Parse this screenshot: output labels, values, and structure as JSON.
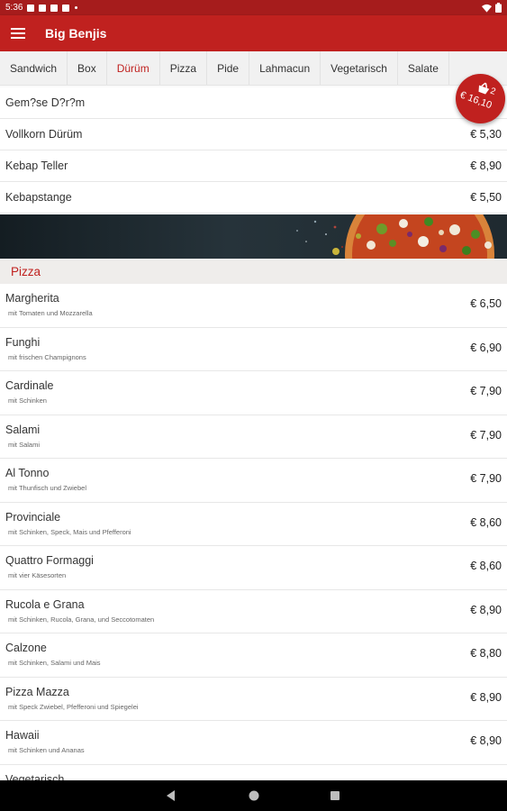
{
  "status_bar": {
    "time": "5:36"
  },
  "app": {
    "title": "Big Benjis"
  },
  "tabs": [
    {
      "label": "Sandwich"
    },
    {
      "label": "Box"
    },
    {
      "label": "Dürüm"
    },
    {
      "label": "Pizza"
    },
    {
      "label": "Pide"
    },
    {
      "label": "Lahmacun"
    },
    {
      "label": "Vegetarisch"
    },
    {
      "label": "Salate"
    }
  ],
  "active_tab": "Dürüm",
  "durum_items": [
    {
      "name": "Gem?se D?r?m",
      "price": ""
    },
    {
      "name": "Vollkorn Dürüm",
      "price": "€ 5,30"
    },
    {
      "name": "Kebap Teller",
      "price": "€ 8,90"
    },
    {
      "name": "Kebapstange",
      "price": "€ 5,50"
    }
  ],
  "pizza_section": {
    "title": "Pizza"
  },
  "pizza_items": [
    {
      "name": "Margherita",
      "desc": "mit Tomaten und Mozzarella",
      "price": "€ 6,50"
    },
    {
      "name": "Funghi",
      "desc": "mit frischen Champignons",
      "price": "€ 6,90"
    },
    {
      "name": "Cardinale",
      "desc": "mit Schinken",
      "price": "€ 7,90"
    },
    {
      "name": "Salami",
      "desc": "mit Salami",
      "price": "€ 7,90"
    },
    {
      "name": "Al Tonno",
      "desc": "mit Thunfisch und Zwiebel",
      "price": "€ 7,90"
    },
    {
      "name": "Provinciale",
      "desc": "mit Schinken, Speck, Mais und Pfefferoni",
      "price": "€ 8,60"
    },
    {
      "name": "Quattro Formaggi",
      "desc": "mit vier Käsesorten",
      "price": "€ 8,60"
    },
    {
      "name": "Rucola e Grana",
      "desc": "mit Schinken, Rucola, Grana, und Seccotomaten",
      "price": "€ 8,90"
    },
    {
      "name": "Calzone",
      "desc": "mit Schinken, Salami und Mais",
      "price": "€ 8,80"
    },
    {
      "name": "Pizza Mazza",
      "desc": "mit Speck Zwiebel, Pfefferoni und Spiegelei",
      "price": "€ 8,90"
    },
    {
      "name": "Hawaii",
      "desc": "mit Schinken und Ananas",
      "price": "€ 8,90"
    },
    {
      "name": "Vegetarisch",
      "desc": "",
      "price": ""
    }
  ],
  "cart": {
    "count": "2",
    "total": "€ 16,10"
  },
  "colors": {
    "primary": "#c0211f",
    "status_bar": "#a61c1c",
    "section_bg": "#efedeb"
  },
  "icons": [
    "menu-icon",
    "basket-icon",
    "wifi-icon",
    "battery-icon",
    "back-icon",
    "home-icon",
    "recents-icon"
  ]
}
